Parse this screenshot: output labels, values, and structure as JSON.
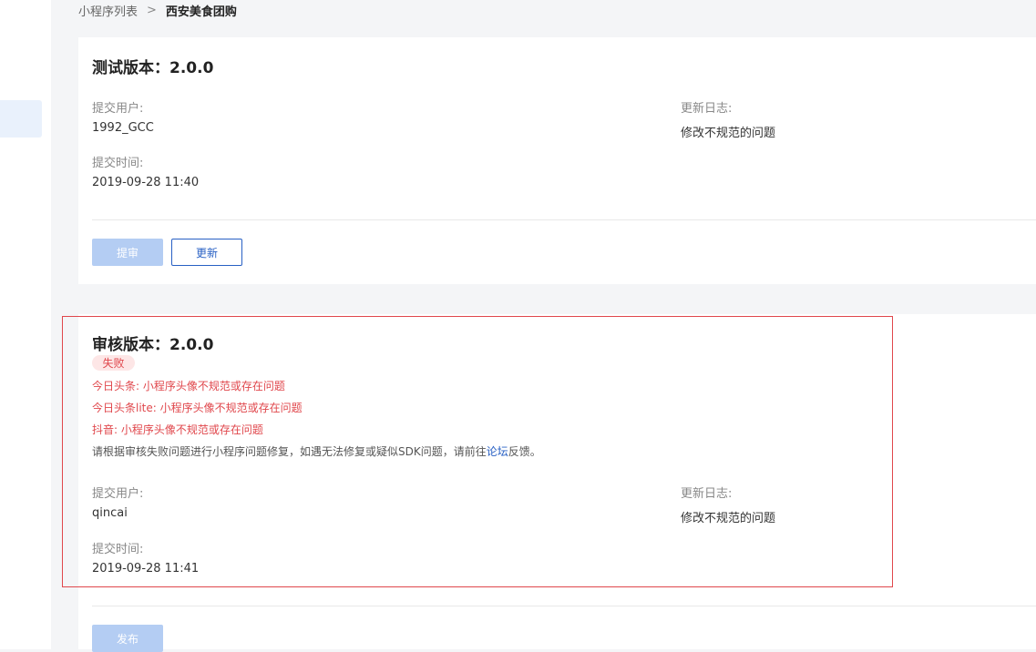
{
  "breadcrumb": {
    "parent": "小程序列表",
    "separator": ">",
    "current": "西安美食团购"
  },
  "test_version": {
    "title": "测试版本：2.0.0",
    "submitter_label": "提交用户:",
    "submitter": "1992_GCC",
    "time_label": "提交时间:",
    "time": "2019-09-28 11:40",
    "changelog_label": "更新日志:",
    "changelog": "修改不规范的问题",
    "submit_review_button": "提审",
    "update_button": "更新"
  },
  "review_version": {
    "title": "审核版本：2.0.0",
    "status": "失败",
    "errors": [
      "今日头条: 小程序头像不规范或存在问题",
      "今日头条lite: 小程序头像不规范或存在问题",
      "抖音: 小程序头像不规范或存在问题"
    ],
    "hint_prefix": "请根据审核失败问题进行小程序问题修复，如遇无法修复或疑似SDK问题，请前往",
    "hint_link": "论坛",
    "hint_suffix": "反馈。",
    "submitter_label": "提交用户:",
    "submitter": "qincai",
    "time_label": "提交时间:",
    "time": "2019-09-28 11:41",
    "changelog_label": "更新日志:",
    "changelog": "修改不规范的问题",
    "publish_button": "发布"
  },
  "colors": {
    "accent": "#2860c4",
    "error": "#e0474c",
    "disabled_button": "#b4cdf3"
  }
}
